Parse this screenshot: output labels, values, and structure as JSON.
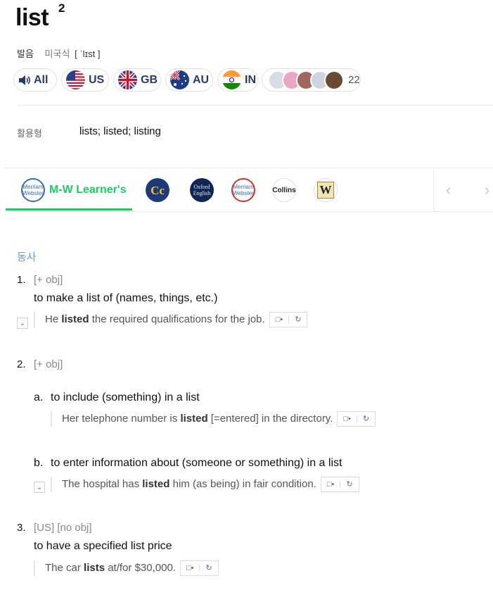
{
  "entry": {
    "word": "list",
    "superscript": "2"
  },
  "pronunciation": {
    "label": "발음",
    "region": "미국식",
    "ipa": "[ ˈlɪst ]"
  },
  "audio_buttons": [
    {
      "label": "All",
      "icon": "speaker-icon"
    },
    {
      "label": "US",
      "icon": "us-flag-icon"
    },
    {
      "label": "GB",
      "icon": "uk-flag-icon"
    },
    {
      "label": "AU",
      "icon": "au-flag-icon"
    },
    {
      "label": "IN",
      "icon": "india-flag-icon"
    }
  ],
  "user_recordings": {
    "count": "22"
  },
  "conjugation": {
    "label": "활용형",
    "value": "lists; listed; listing"
  },
  "dictionary_tabs": {
    "active_label": "M-W Learner's",
    "accent_color": "#19ce60",
    "icons": [
      {
        "name": "merriam-webster-learners-logo",
        "text": "Merriam Webster"
      },
      {
        "name": "collins-cobuild-logo",
        "text": "Cc"
      },
      {
        "name": "oxford-english-logo",
        "text": "Oxford English"
      },
      {
        "name": "merriam-webster-logo",
        "text": "Merriam Webster"
      },
      {
        "name": "collins-logo",
        "text": "Collins"
      },
      {
        "name": "wordnet-logo",
        "text": "W"
      }
    ]
  },
  "part_of_speech": "동사",
  "senses": {
    "s1": {
      "num": "1.",
      "tag": "[+ obj]",
      "definition": "to make a list of (names, things, etc.)",
      "example": {
        "pre": "He ",
        "bold": "listed",
        "post": " the required qualifications for the job."
      }
    },
    "s2": {
      "num": "2.",
      "tag": "[+ obj]",
      "a": {
        "num": "a.",
        "definition": "to include (something) in a list",
        "example": {
          "pre": "Her telephone number is ",
          "bold": "listed",
          "post": " [=entered] in the directory."
        }
      },
      "b": {
        "num": "b.",
        "definition": "to enter information about (someone or something) in a list",
        "example": {
          "pre": "The hospital has ",
          "bold": "listed",
          "post": " him (as being) in fair condition."
        }
      }
    },
    "s3": {
      "num": "3.",
      "tag": "[US] [no obj]",
      "definition": "to have a specified list price",
      "example": {
        "pre": "The car ",
        "bold": "lists",
        "post": " at/for $30,000."
      }
    }
  }
}
